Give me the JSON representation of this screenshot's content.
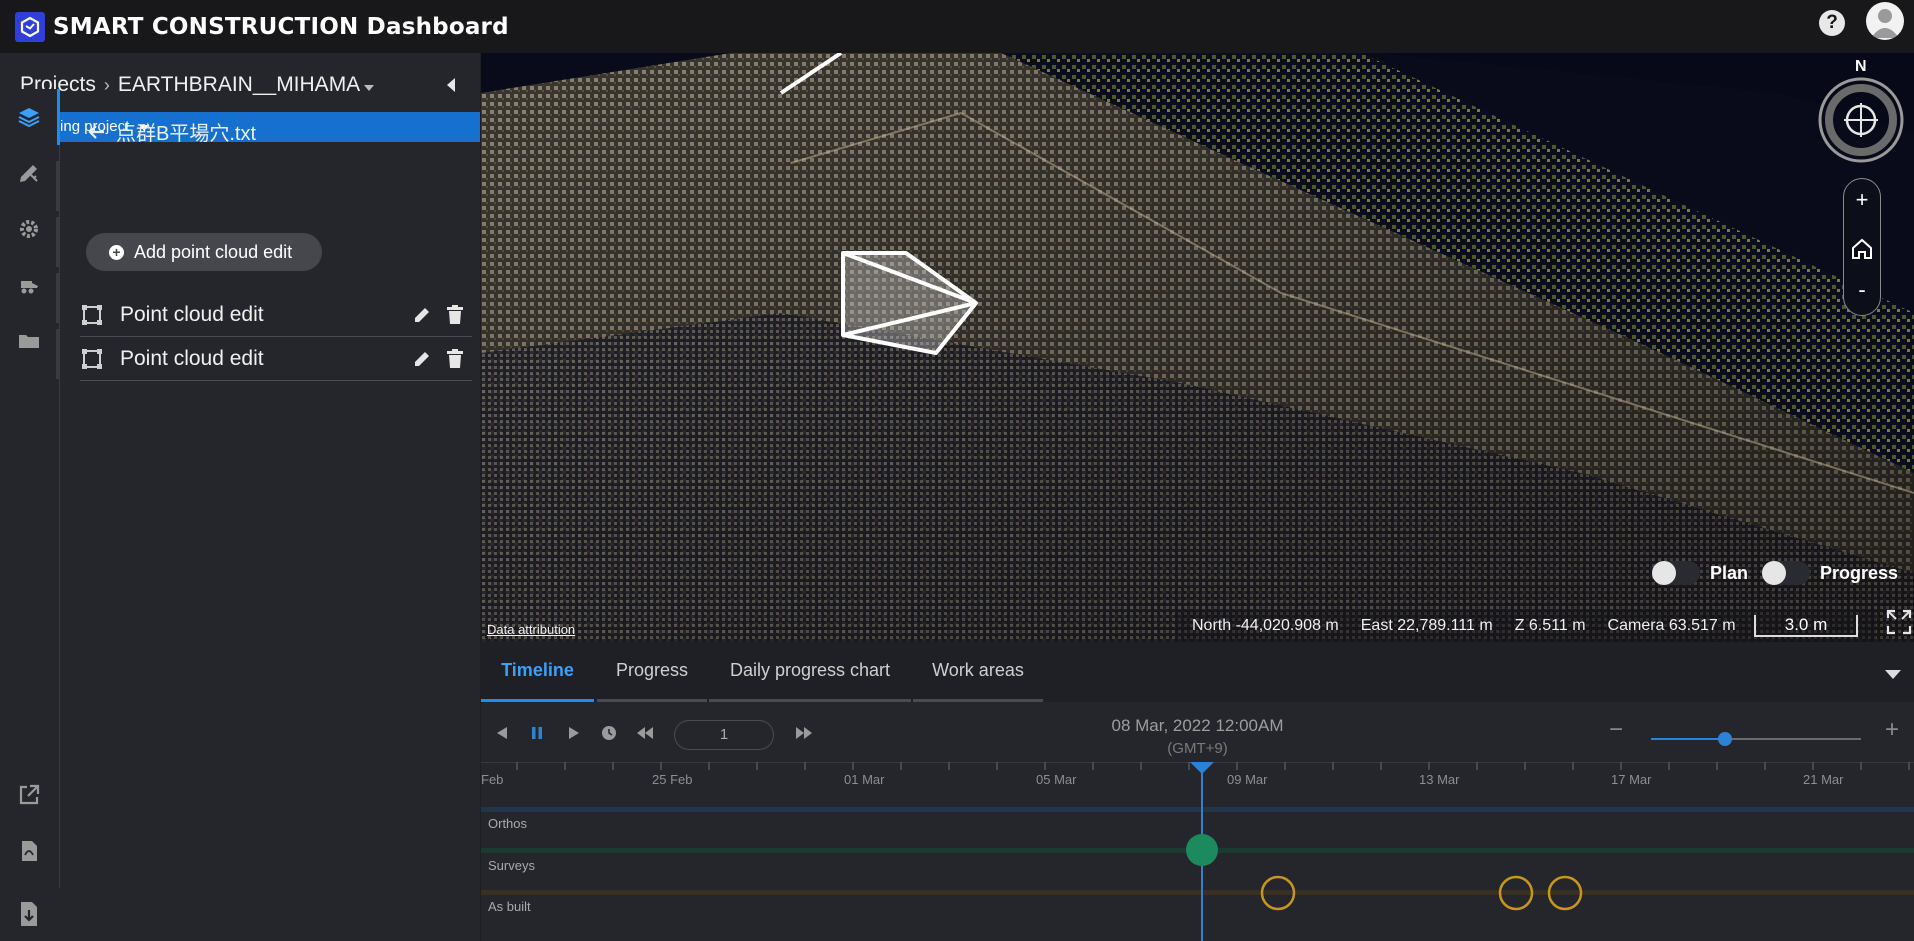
{
  "app": {
    "title": "SMART CONSTRUCTION Dashboard",
    "logo_icon": "smart-construction-logo-icon",
    "help_icon": "question-circle-icon",
    "avatar_icon": "user-avatar-icon"
  },
  "colors": {
    "accent": "#1d8cf8",
    "update_bar": "#1670d0",
    "survey_marker": "#1c8a5c",
    "asbuilt_marker": "#c8961e"
  },
  "side_panel": {
    "breadcrumb": {
      "root": "Projects",
      "separator": "›",
      "project": "EARTHBRAIN__MIHAMA"
    },
    "update_status": "Updating project",
    "rail_items": [
      {
        "icon": "layers-icon",
        "active": true
      },
      {
        "icon": "design-tools-icon",
        "active": false
      },
      {
        "icon": "gear-icon",
        "active": false
      },
      {
        "icon": "machine-icon",
        "active": false
      },
      {
        "icon": "folder-icon",
        "active": false
      },
      {
        "icon": "external-link-icon",
        "active": false
      },
      {
        "icon": "pdf-icon",
        "active": false
      },
      {
        "icon": "download-icon",
        "active": false
      }
    ],
    "file_name": "点群B平場穴.txt",
    "add_button": "Add point cloud edit",
    "edits": [
      {
        "label": "Point cloud edit"
      },
      {
        "label": "Point cloud edit"
      }
    ]
  },
  "map": {
    "compass_label": "N",
    "zoom_in": "+",
    "zoom_out": "-",
    "toggles": [
      {
        "label": "Plan",
        "on": false
      },
      {
        "label": "Progress",
        "on": false
      }
    ],
    "attribution": "Data attribution",
    "coords": {
      "north": "North -44,020.908 m",
      "east": "East 22,789.111 m",
      "z": "Z 6.511 m",
      "camera": "Camera 63.517 m"
    },
    "scale": "3.0 m"
  },
  "timeline": {
    "tabs": [
      {
        "label": "Timeline",
        "active": true
      },
      {
        "label": "Progress",
        "active": false
      },
      {
        "label": "Daily progress chart",
        "active": false
      },
      {
        "label": "Work areas",
        "active": false
      }
    ],
    "step_value": "1",
    "date": "08 Mar, 2022 12:00AM",
    "timezone": "(GMT+9)",
    "zoom_level": 0.35,
    "ticks": [
      "Feb",
      "25 Feb",
      "01 Mar",
      "05 Mar",
      "09 Mar",
      "13 Mar",
      "17 Mar",
      "21 Mar"
    ],
    "rows": [
      "Orthos",
      "Surveys",
      "As built"
    ]
  }
}
